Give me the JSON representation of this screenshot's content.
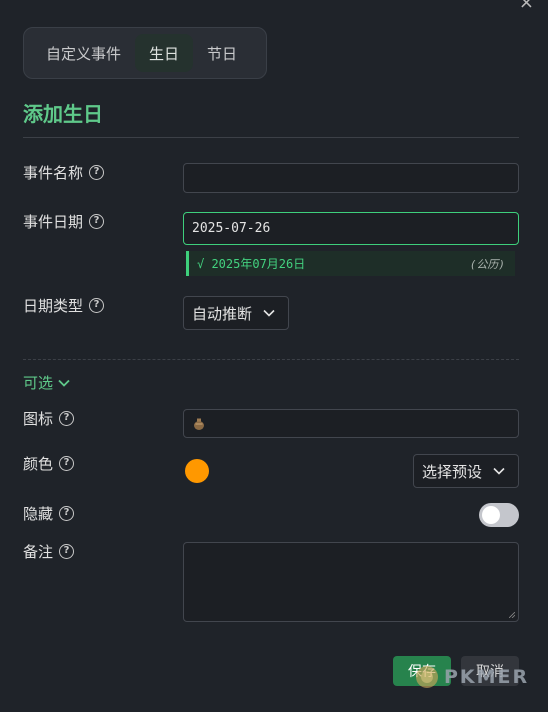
{
  "window": {
    "close_glyph": "×"
  },
  "tabs": [
    {
      "label": "自定义事件",
      "active": false
    },
    {
      "label": "生日",
      "active": true
    },
    {
      "label": "节日",
      "active": false
    }
  ],
  "title": "添加生日",
  "fields": {
    "event_name": {
      "label": "事件名称",
      "value": "",
      "help": "?"
    },
    "event_date": {
      "label": "事件日期",
      "value": "2025-07-26",
      "help": "?"
    },
    "date_hint": {
      "check": "√ 2025年07月26日",
      "calendar": "(公历)"
    },
    "date_type": {
      "label": "日期类型",
      "value": "自动推断",
      "help": "?"
    }
  },
  "optional": {
    "label": "可选",
    "icon": {
      "label": "图标",
      "value": "🏺",
      "help": "?"
    },
    "color": {
      "label": "颜色",
      "value": "#ff9800",
      "preset_label": "选择预设",
      "help": "?"
    },
    "hidden": {
      "label": "隐藏",
      "on": false,
      "help": "?"
    },
    "note": {
      "label": "备注",
      "value": "",
      "help": "?"
    }
  },
  "buttons": {
    "save": "保存",
    "cancel": "取消"
  },
  "watermark": "PKMER",
  "colors": {
    "accent": "#3ecf7c",
    "title": "#5fc98a",
    "save": "#27834d",
    "orange": "#ff9800"
  }
}
